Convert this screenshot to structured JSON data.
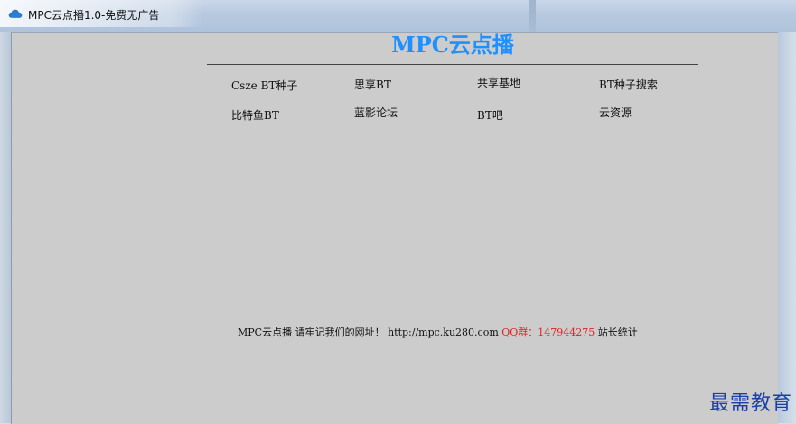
{
  "window": {
    "title": "MPC云点播1.0-免费无广告",
    "icon": "cloud-icon",
    "icon_color": "#2a7fd4"
  },
  "page": {
    "title": "MPC云点播",
    "title_color": "#1e90ff",
    "links": [
      {
        "label": "Csze BT种子"
      },
      {
        "label": "思享BT"
      },
      {
        "label": "共享基地"
      },
      {
        "label": "BT种子搜索"
      },
      {
        "label": "比特鱼BT"
      },
      {
        "label": "蓝影论坛"
      },
      {
        "label": "BT吧"
      },
      {
        "label": "云资源"
      }
    ],
    "footer": {
      "prefix": "MPC云点播 请牢记我们的网址！",
      "url": "http://mpc.ku280.com",
      "qq_label": "QQ群：",
      "qq_number": "147944275",
      "stats": "站长统计",
      "accent_color": "#e02020"
    }
  },
  "watermark": {
    "text": "最需教育"
  }
}
